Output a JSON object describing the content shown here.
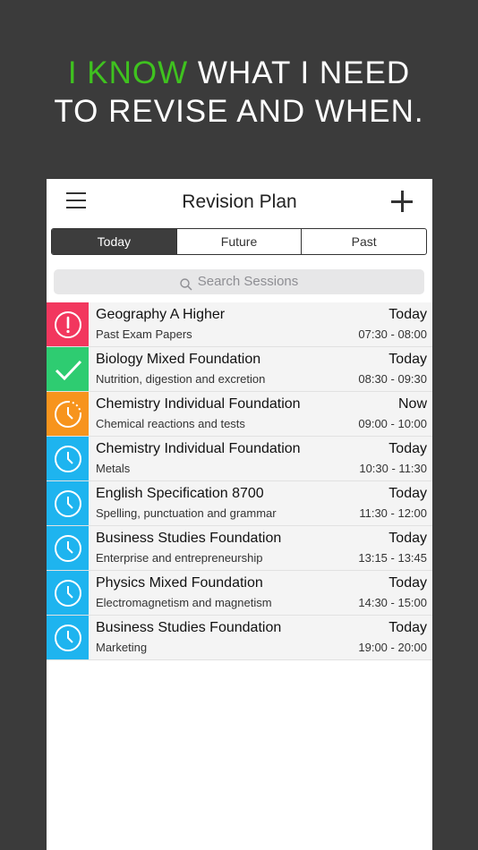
{
  "headline": {
    "highlight": "I KNOW",
    "line1_rest": " WHAT I NEED",
    "line2": "TO REVISE AND WHEN."
  },
  "colors": {
    "background": "#3b3b3b",
    "highlight": "#3fc21f",
    "overdue": "#f2375e",
    "done": "#2ecc71",
    "now": "#f7941d",
    "scheduled": "#1eb4ef"
  },
  "navbar": {
    "menu_icon": "hamburger-icon",
    "title": "Revision Plan",
    "add_icon": "plus-icon"
  },
  "tabs": [
    {
      "label": "Today",
      "active": true
    },
    {
      "label": "Future",
      "active": false
    },
    {
      "label": "Past",
      "active": false
    }
  ],
  "search": {
    "placeholder": "Search Sessions",
    "icon": "search-icon"
  },
  "sessions": [
    {
      "title": "Geography A Higher",
      "subtitle": "Past Exam Papers",
      "when": "Today",
      "time": "07:30 - 08:00",
      "status": "overdue",
      "icon": "alert-icon"
    },
    {
      "title": "Biology Mixed Foundation",
      "subtitle": "Nutrition, digestion and excretion",
      "when": "Today",
      "time": "08:30 - 09:30",
      "status": "done",
      "icon": "check-icon"
    },
    {
      "title": "Chemistry Individual Foundation",
      "subtitle": "Chemical reactions and tests",
      "when": "Now",
      "time": "09:00 - 10:00",
      "status": "now",
      "icon": "clock-progress-icon"
    },
    {
      "title": "Chemistry Individual Foundation",
      "subtitle": "Metals",
      "when": "Today",
      "time": "10:30 - 11:30",
      "status": "scheduled",
      "icon": "clock-icon"
    },
    {
      "title": "English Specification 8700",
      "subtitle": "Spelling, punctuation and grammar",
      "when": "Today",
      "time": "11:30 - 12:00",
      "status": "scheduled",
      "icon": "clock-icon"
    },
    {
      "title": "Business Studies Foundation",
      "subtitle": "Enterprise and entrepreneurship",
      "when": "Today",
      "time": "13:15 - 13:45",
      "status": "scheduled",
      "icon": "clock-icon"
    },
    {
      "title": "Physics Mixed Foundation",
      "subtitle": "Electromagnetism and magnetism",
      "when": "Today",
      "time": "14:30 - 15:00",
      "status": "scheduled",
      "icon": "clock-icon"
    },
    {
      "title": "Business Studies Foundation",
      "subtitle": "Marketing",
      "when": "Today",
      "time": "19:00 - 20:00",
      "status": "scheduled",
      "icon": "clock-icon"
    }
  ]
}
